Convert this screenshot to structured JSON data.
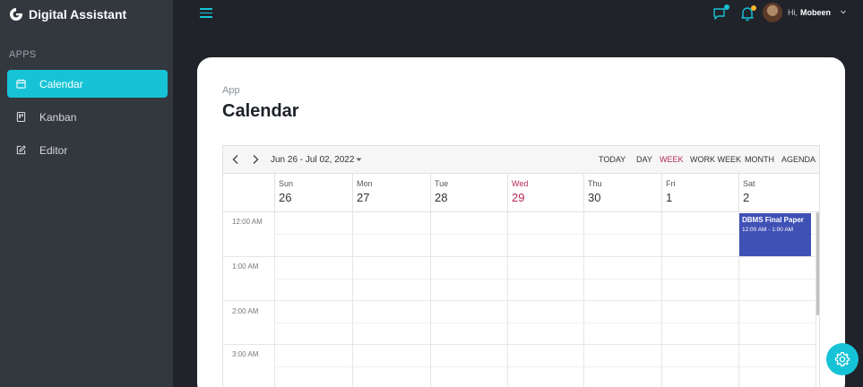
{
  "app": {
    "title": "Digital Assistant"
  },
  "colors": {
    "accent": "#16c3d6",
    "today": "#b5295c",
    "event": "#3f51b5",
    "chat_dot": "#16c3d6",
    "bell_dot": "#f5b82e"
  },
  "sidebar": {
    "section": "APPS",
    "items": [
      {
        "label": "Calendar",
        "icon": "calendar-icon",
        "active": true
      },
      {
        "label": "Kanban",
        "icon": "kanban-icon",
        "active": false
      },
      {
        "label": "Editor",
        "icon": "edit-icon",
        "active": false
      }
    ]
  },
  "topbar": {
    "greeting": "Hi,",
    "user_name": "Mobeen"
  },
  "page": {
    "breadcrumb": "App",
    "title": "Calendar"
  },
  "calendar": {
    "date_range": "Jun 26 - Jul 02, 2022",
    "views": [
      "TODAY",
      "DAY",
      "WEEK",
      "WORK WEEK",
      "MONTH",
      "AGENDA"
    ],
    "active_view": "WEEK",
    "days": [
      {
        "name": "Sun",
        "date": "26"
      },
      {
        "name": "Mon",
        "date": "27"
      },
      {
        "name": "Tue",
        "date": "28"
      },
      {
        "name": "Wed",
        "date": "29",
        "today": true
      },
      {
        "name": "Thu",
        "date": "30"
      },
      {
        "name": "Fri",
        "date": "1"
      },
      {
        "name": "Sat",
        "date": "2"
      }
    ],
    "time_slots": [
      "12:00 AM",
      "1:00 AM",
      "2:00 AM",
      "3:00 AM"
    ],
    "events": [
      {
        "title": "DBMS Final Paper",
        "time": "12:00 AM - 1:00 AM",
        "day": "Sat"
      }
    ]
  }
}
